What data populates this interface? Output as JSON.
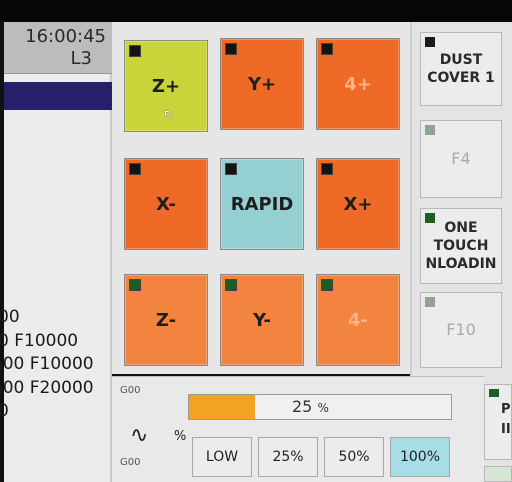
{
  "status": {
    "time": "16:00:45",
    "line": "L3"
  },
  "gcode_lines": [
    "00",
    "0 F10000",
    "i00 F10000",
    "i00 F20000",
    "0"
  ],
  "jog_buttons": [
    {
      "label": "Z+",
      "color": "#c8d43a"
    },
    {
      "label": "Y+",
      "color": "#ee6a26"
    },
    {
      "label": "4+",
      "color": "#ee6a26",
      "enabled": false
    },
    {
      "label": "X-",
      "color": "#ee6a26"
    },
    {
      "label": "RAPID",
      "color": "#94d0d2"
    },
    {
      "label": "X+",
      "color": "#ee6a26"
    },
    {
      "label": "Z-",
      "color": "#f2843f"
    },
    {
      "label": "Y-",
      "color": "#f2843f"
    },
    {
      "label": "4-",
      "color": "#f2843f",
      "enabled": false
    }
  ],
  "function_buttons": [
    {
      "label_line1": "DUST",
      "label_line2": "COVER 1"
    },
    {
      "label": "F4"
    },
    {
      "label_line1": "ONE",
      "label_line2": "TOUCH",
      "label_line3": "NLOADIN"
    },
    {
      "label": "F10"
    }
  ],
  "override": {
    "mode_top": "G00",
    "mode_bottom": "G00",
    "value_percent": 25,
    "value_text": "25",
    "percent_sign": "%",
    "wave_icon": "feed-wave-icon",
    "wave_glyph": "∿",
    "wave_percent": "%",
    "speed_options": [
      "LOW",
      "25%",
      "50%",
      "100%"
    ],
    "selected_speed": "100%"
  },
  "partial_button": {
    "line1": "P",
    "line2": "II"
  },
  "colors": {
    "accent_blue": "#26216a",
    "orange": "#ee6a26",
    "lime": "#c8d43a",
    "cyan": "#94d0d2",
    "override_fill": "#f0a422"
  }
}
